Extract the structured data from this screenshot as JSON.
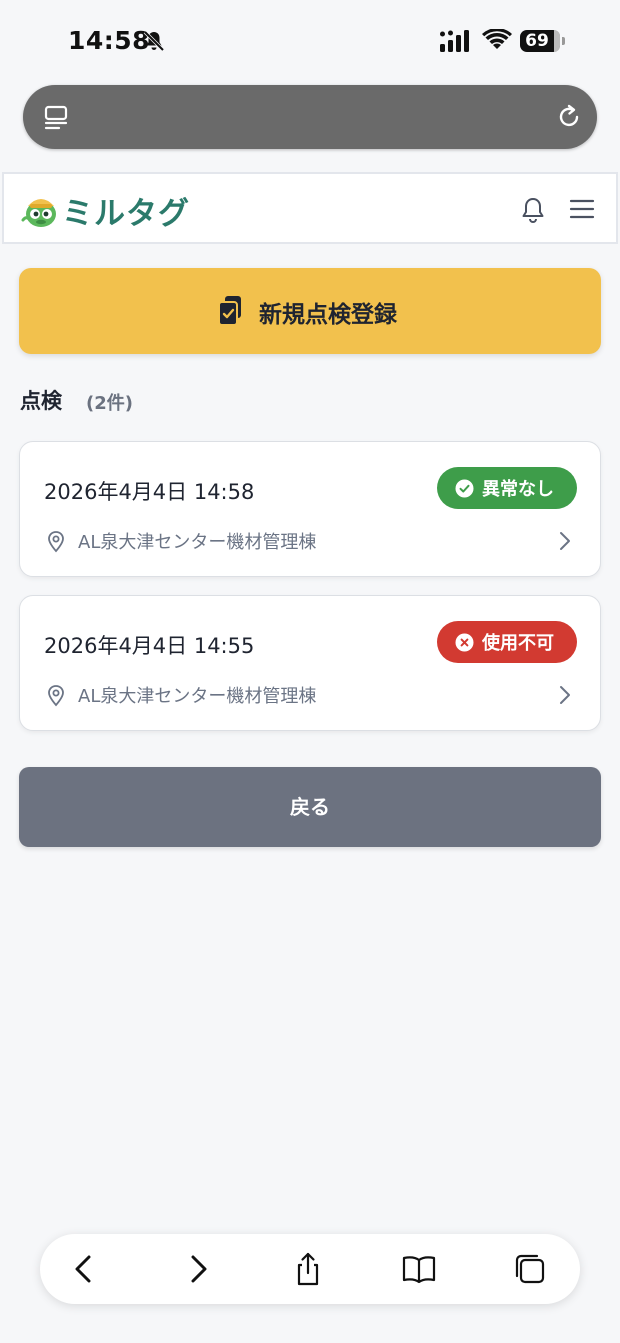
{
  "status_bar": {
    "time": "14:58",
    "battery": "69"
  },
  "app": {
    "logo_text": "ミルタグ"
  },
  "register_button": {
    "label": "新規点検登録"
  },
  "inspections": {
    "title": "点検",
    "count": "(2件)",
    "items": [
      {
        "date": "2026年4月4日 14:58",
        "status": "異常なし",
        "location": "AL泉大津センター機材管理棟",
        "status_color": "#3e9d4a"
      },
      {
        "date": "2026年4月4日 14:55",
        "status": "使用不可",
        "location": "AL泉大津センター機材管理棟",
        "status_color": "#d23a31"
      }
    ]
  },
  "back_button": {
    "label": "戻る"
  },
  "colors": {
    "accent": "#f2c14d",
    "brand": "#2b7a6b",
    "back": "#6c7280"
  }
}
